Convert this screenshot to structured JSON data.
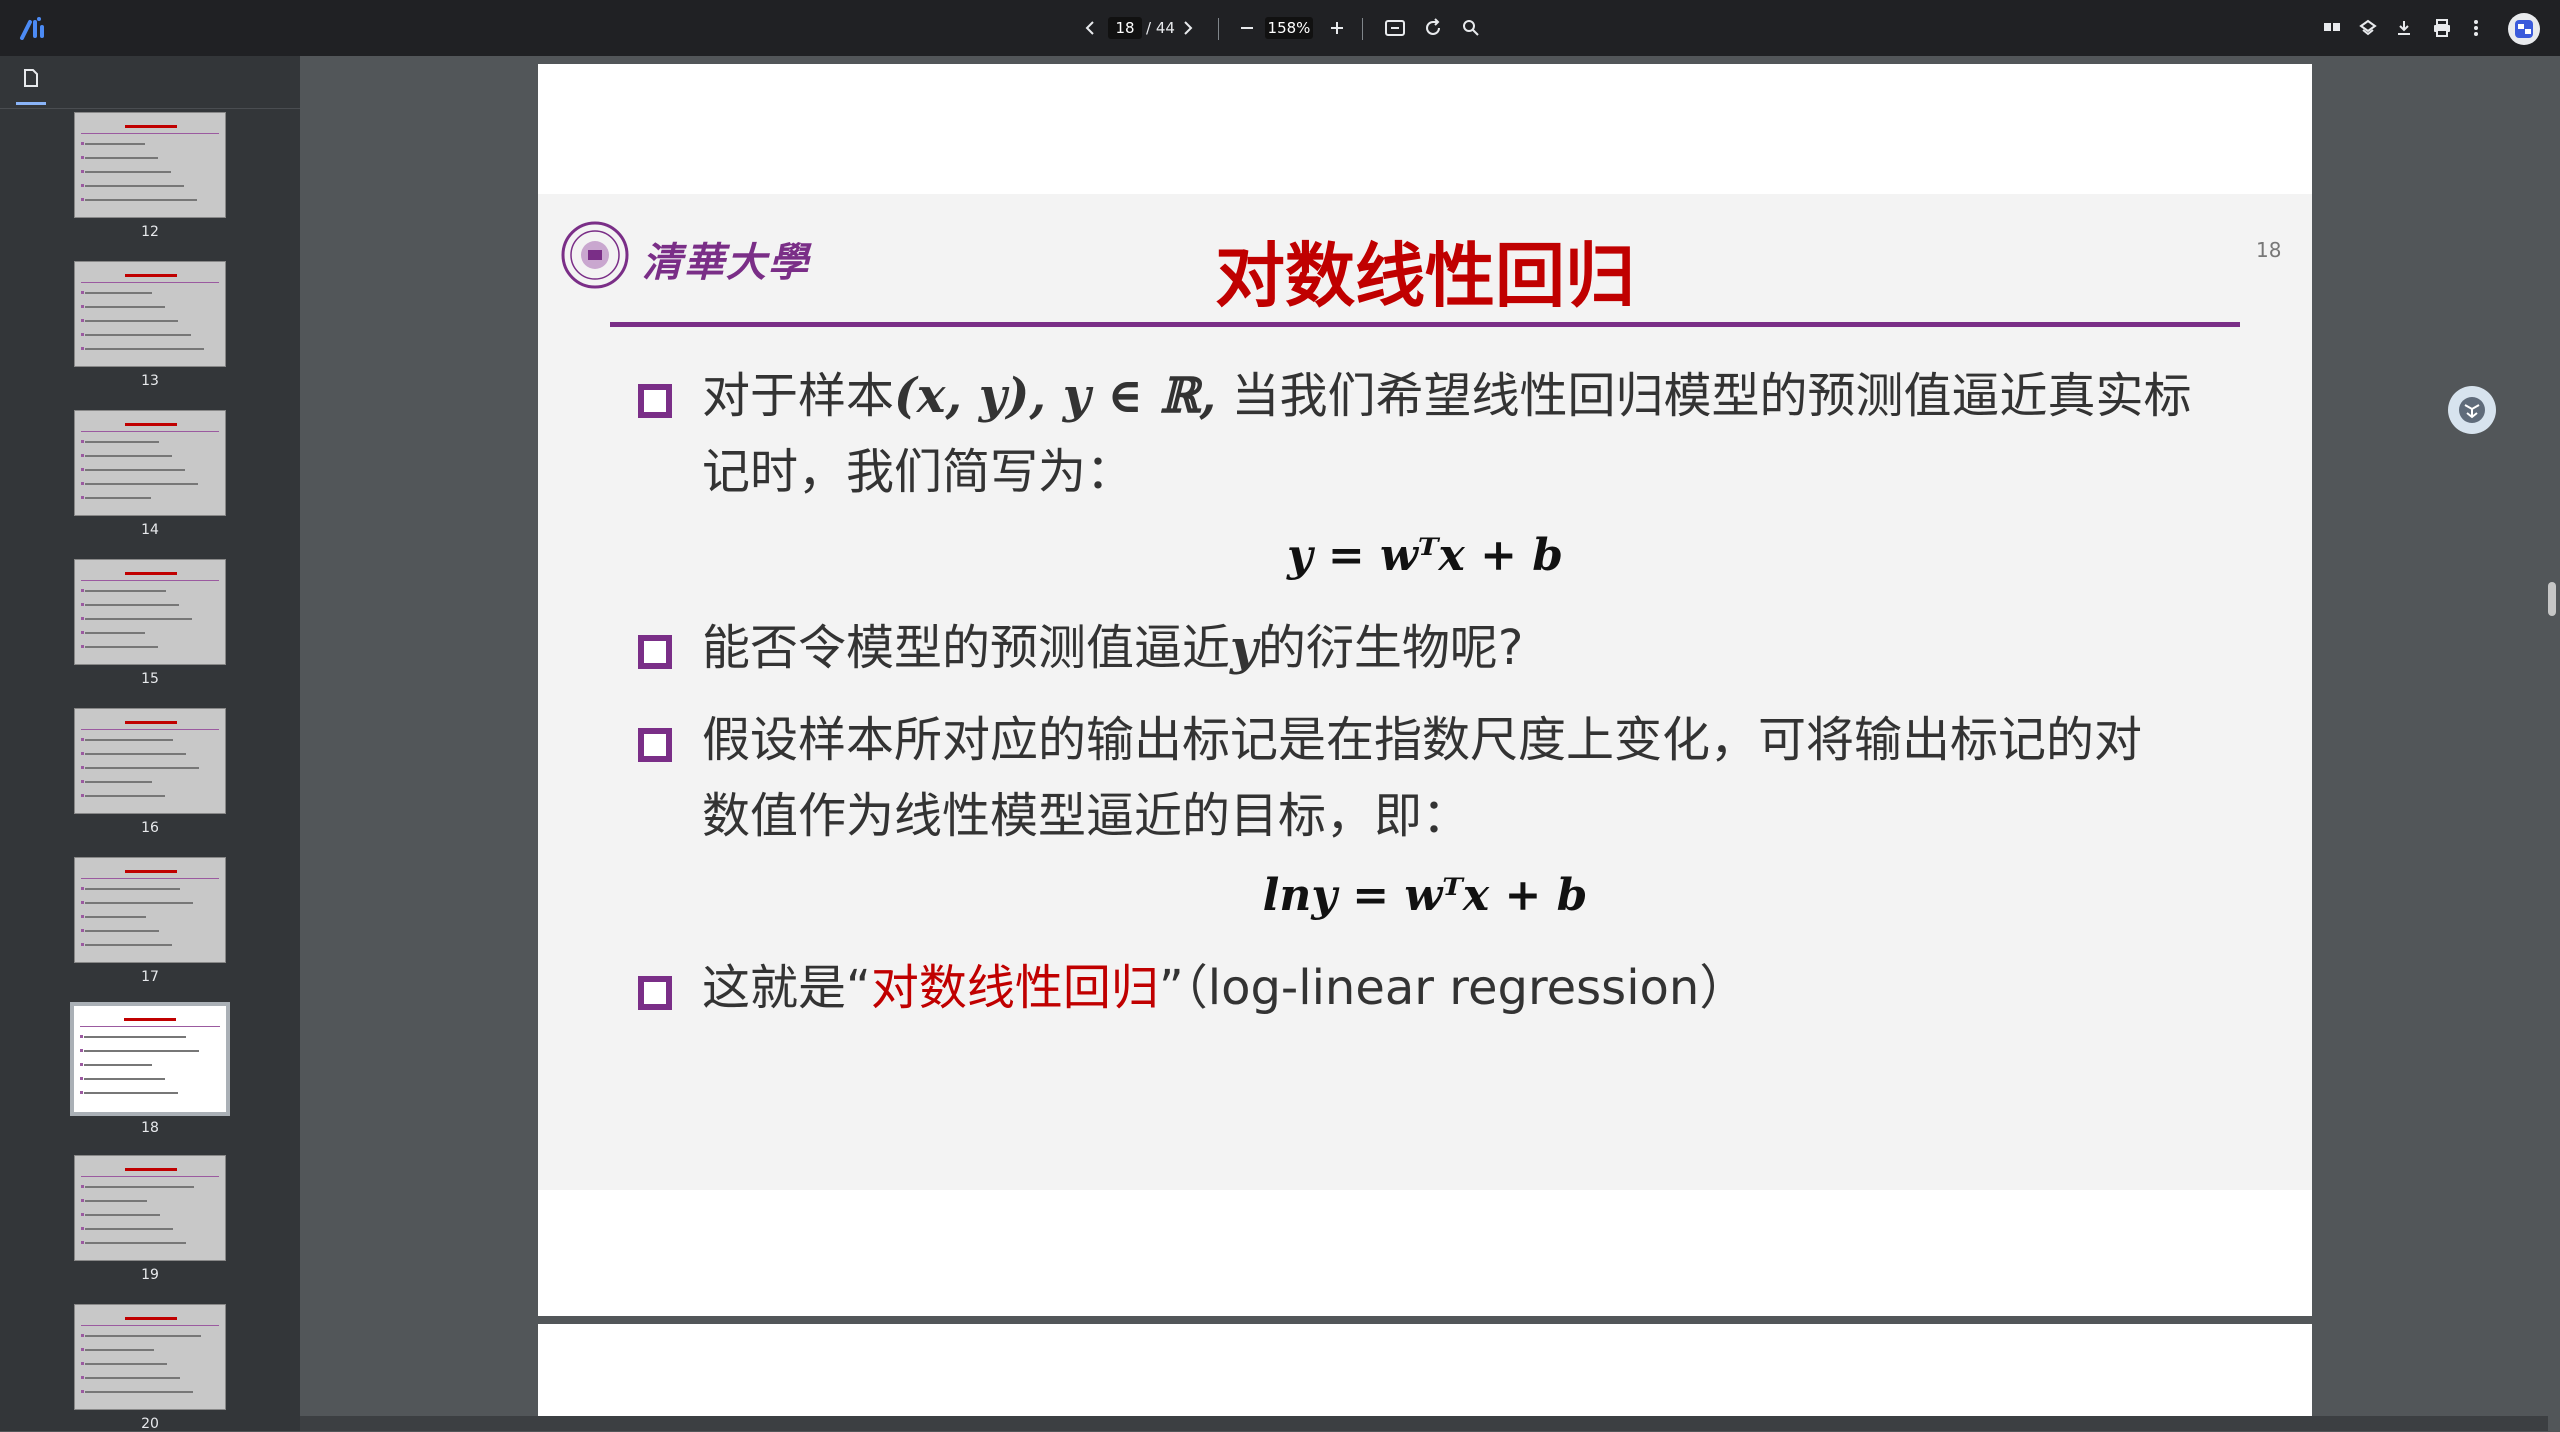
{
  "toolbar": {
    "page_current": "18",
    "page_total": "/ 44",
    "zoom": "158%"
  },
  "thumbnails": [
    {
      "num": "12",
      "active": false
    },
    {
      "num": "13",
      "active": false
    },
    {
      "num": "14",
      "active": false
    },
    {
      "num": "15",
      "active": false
    },
    {
      "num": "16",
      "active": false
    },
    {
      "num": "17",
      "active": false
    },
    {
      "num": "18",
      "active": true
    },
    {
      "num": "19",
      "active": false
    },
    {
      "num": "20",
      "active": false
    }
  ],
  "slide": {
    "number": "18",
    "logo_text": "清華大學",
    "title": "对数线性回归",
    "b1_prefix": "对于样本",
    "b1_math": "(x, y), y ∈ ℝ,",
    "b1_rest": " 当我们希望线性回归模型的预测值逼近真实标",
    "b1_line2": "记时，我们简写为：",
    "formula1": "y = wᵀx + b",
    "b2_prefix": "能否令模型的预测值逼近",
    "b2_math": "y",
    "b2_suffix": "的衍生物呢?",
    "b3_line1": "假设样本所对应的输出标记是在指数尺度上变化，可将输出标记的对",
    "b3_line2": "数值作为线性模型逼近的目标，即：",
    "formula2": "lny = wᵀx + b",
    "b4_prefix": "这就是“",
    "b4_red": "对数线性回归",
    "b4_suffix": "”（log-linear regression）"
  },
  "colors": {
    "accent_purple": "#7a2e87",
    "title_red": "#c00000",
    "toolbar_bg": "#202124",
    "sidebar_bg": "#333639"
  },
  "icons": [
    "app-logo-icon",
    "prev-page-icon",
    "next-page-icon",
    "zoom-out-icon",
    "zoom-in-icon",
    "fit-page-icon",
    "rotate-icon",
    "search-icon",
    "bookmark-icon",
    "save-icon",
    "download-icon",
    "print-icon",
    "more-icon",
    "thumbnail-icon"
  ]
}
